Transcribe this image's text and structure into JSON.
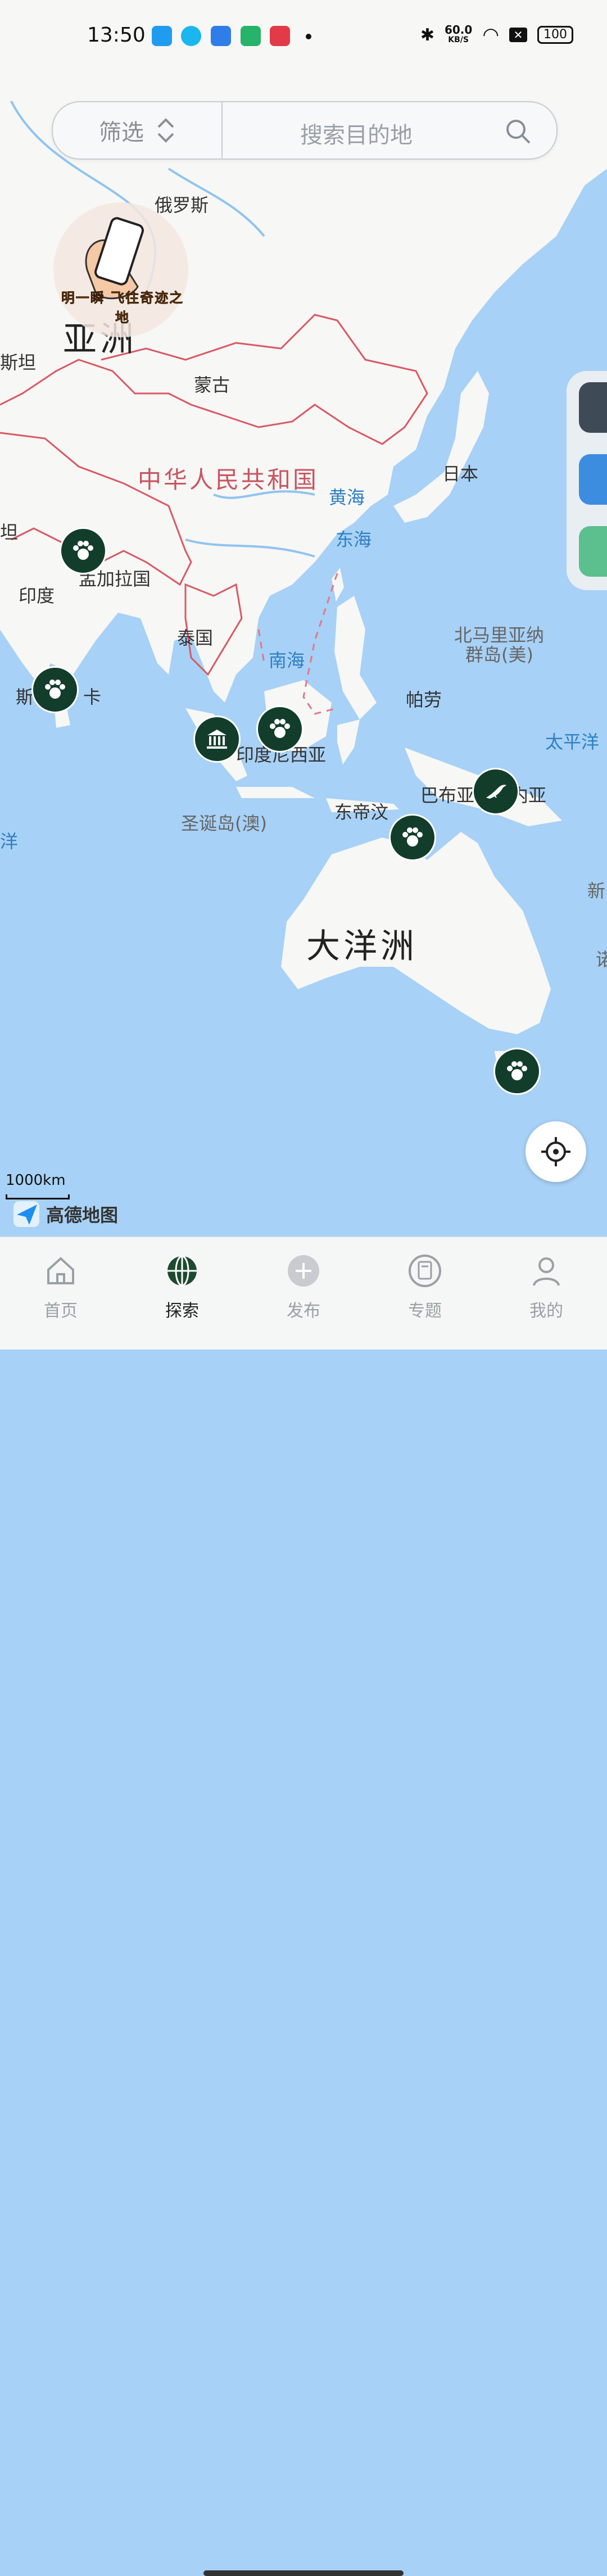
{
  "status": {
    "time": "13:50",
    "speed_value": "60.0",
    "speed_unit": "KB/S",
    "battery": "100",
    "app_icons": [
      "#1f9cf0",
      "#19b6f0",
      "#2f7de8",
      "#26b36a",
      "#e23b47"
    ]
  },
  "search": {
    "filter_label": "筛选",
    "placeholder": "搜索目的地"
  },
  "map": {
    "labels": {
      "russia": "俄罗斯",
      "asia": "亚洲",
      "stan": "斯坦",
      "mongolia": "蒙古",
      "china": "中华人民共和国",
      "yellow_sea": "黄海",
      "east_sea": "东海",
      "japan": "日本",
      "tan": "坦",
      "bangladesh": "孟加拉国",
      "india": "印度",
      "thailand": "泰国",
      "south_sea": "南海",
      "nmi_line1": "北马里亚纳",
      "nmi_line2": "群岛(美)",
      "palau": "帕劳",
      "srilanka_left": "斯",
      "srilanka_right": "卡",
      "pacific": "太平洋",
      "indonesia": "印度尼西亚",
      "papua": "巴布亚新几内亚",
      "christmas": "圣诞岛(澳)",
      "timor": "东帝汶",
      "yang": "洋",
      "xin": "新",
      "nuo": "诺",
      "oceania": "大洋洲"
    },
    "badge_text": "明一瞬 飞往奇迹之地",
    "scale": "1000km",
    "brand": "高德地图"
  },
  "pins": [
    {
      "icon": "paw-icon"
    },
    {
      "icon": "paw-icon"
    },
    {
      "icon": "museum-icon"
    },
    {
      "icon": "paw-icon"
    },
    {
      "icon": "bird-icon"
    },
    {
      "icon": "paw-icon"
    },
    {
      "icon": "paw-icon"
    }
  ],
  "tabs": [
    {
      "label": "首页",
      "icon": "home-icon"
    },
    {
      "label": "探索",
      "icon": "globe-icon"
    },
    {
      "label": "发布",
      "icon": "plus-icon"
    },
    {
      "label": "专题",
      "icon": "topic-icon"
    },
    {
      "label": "我的",
      "icon": "user-icon"
    }
  ],
  "colors": {
    "ocean": "#a7d1f6",
    "land": "#f7f7f5",
    "border": "#d95864",
    "pin": "#123d2b",
    "active_tab": "#1e4a30"
  }
}
